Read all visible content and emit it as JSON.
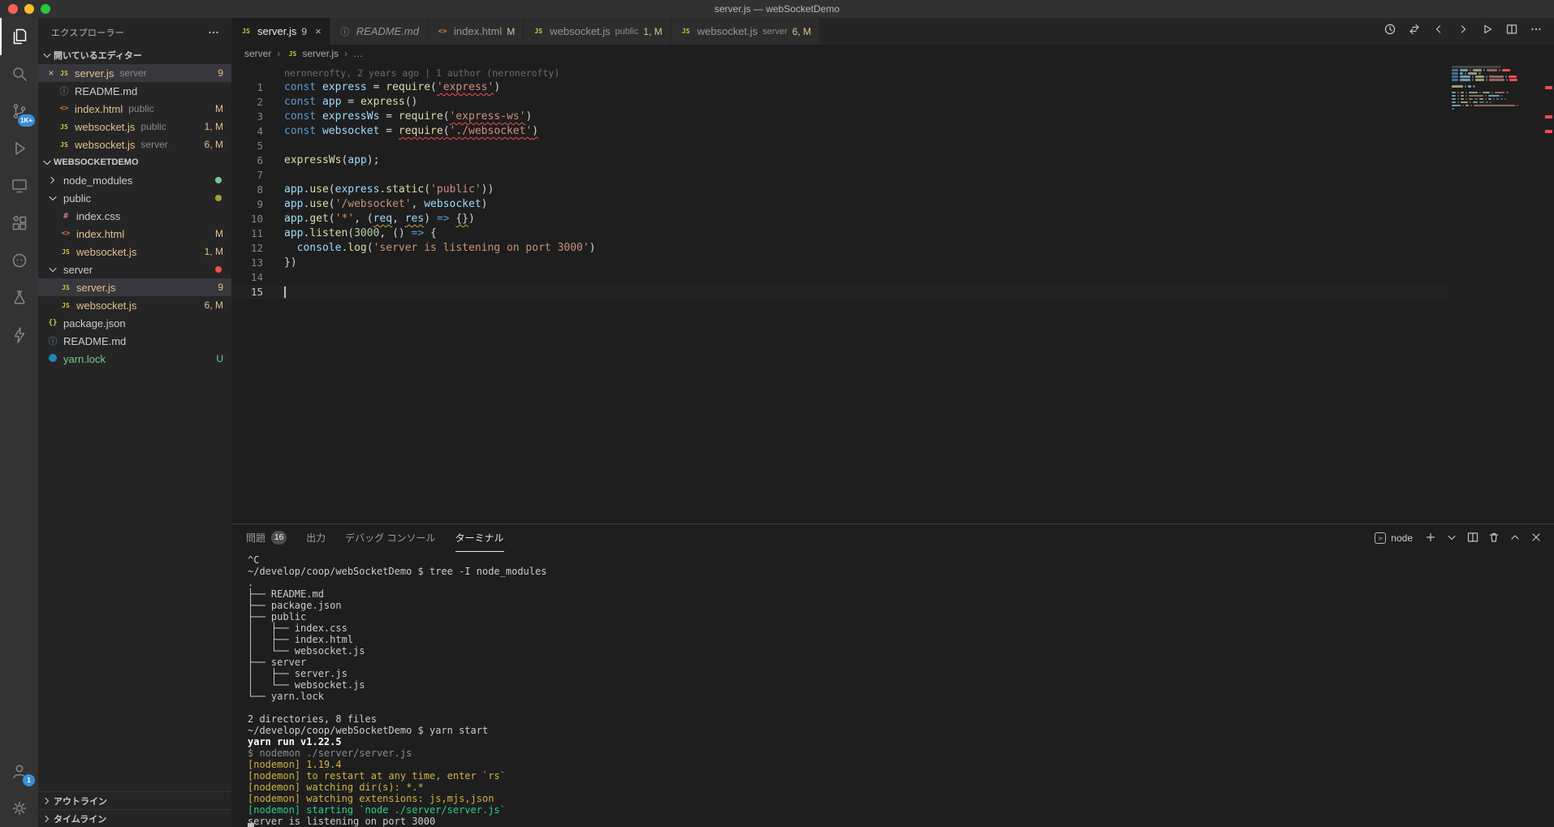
{
  "title_bar": {
    "title": "server.js — webSocketDemo"
  },
  "activity_bar": {
    "top": [
      {
        "id": "explorer",
        "active": true
      },
      {
        "id": "search"
      },
      {
        "id": "source-control",
        "badge": "1K+"
      },
      {
        "id": "run-debug"
      },
      {
        "id": "remote-explorer"
      },
      {
        "id": "extensions"
      },
      {
        "id": "github"
      },
      {
        "id": "testing"
      },
      {
        "id": "lightning"
      }
    ],
    "bottom": [
      {
        "id": "accounts",
        "badge": "1"
      },
      {
        "id": "settings"
      }
    ]
  },
  "sidebar": {
    "title": "エクスプローラー",
    "open_editors": {
      "header": "開いているエディター",
      "items": [
        {
          "icon": "js",
          "name": "server.js",
          "detail": "server",
          "badge": "9",
          "color": "mod",
          "selected": true,
          "close": true
        },
        {
          "icon": "info",
          "name": "README.md",
          "color": "plain"
        },
        {
          "icon": "html",
          "name": "index.html",
          "detail": "public",
          "badge": "M",
          "color": "mod"
        },
        {
          "icon": "js",
          "name": "websocket.js",
          "detail": "public",
          "badge": "1, M",
          "color": "mod"
        },
        {
          "icon": "js",
          "name": "websocket.js",
          "detail": "server",
          "badge": "6, M",
          "color": "mod"
        }
      ]
    },
    "tree": {
      "root": "WEBSOCKETDEMO",
      "items": [
        {
          "type": "folder",
          "name": "node_modules",
          "expanded": false,
          "indent": 0,
          "dot": "#73c991",
          "color": "plain"
        },
        {
          "type": "folder",
          "name": "public",
          "expanded": true,
          "indent": 0,
          "dot": "#a8a238",
          "color": "plain"
        },
        {
          "type": "file",
          "icon": "css",
          "name": "index.css",
          "indent": 1,
          "color": "plain"
        },
        {
          "type": "file",
          "icon": "html",
          "name": "index.html",
          "indent": 1,
          "badge": "M",
          "color": "mod"
        },
        {
          "type": "file",
          "icon": "js",
          "name": "websocket.js",
          "indent": 1,
          "badge": "1, M",
          "color": "mod"
        },
        {
          "type": "folder",
          "name": "server",
          "expanded": true,
          "indent": 0,
          "dot": "#f14c4c",
          "color": "plain"
        },
        {
          "type": "file",
          "icon": "js",
          "name": "server.js",
          "indent": 1,
          "badge": "9",
          "color": "mod",
          "selected": true
        },
        {
          "type": "file",
          "icon": "js",
          "name": "websocket.js",
          "indent": 1,
          "badge": "6, M",
          "color": "mod"
        },
        {
          "type": "file",
          "icon": "json",
          "name": "package.json",
          "indent": 0,
          "color": "plain"
        },
        {
          "type": "file",
          "icon": "info",
          "name": "README.md",
          "indent": 0,
          "color": "plain"
        },
        {
          "type": "file",
          "icon": "yarn",
          "name": "yarn.lock",
          "indent": 0,
          "badge": "U",
          "color": "untracked"
        }
      ]
    },
    "bottom_sections": [
      {
        "label": "アウトライン"
      },
      {
        "label": "タイムライン"
      }
    ]
  },
  "tab_bar": {
    "tabs": [
      {
        "icon": "js",
        "label": "server.js",
        "badge": "9",
        "active": true,
        "close": true
      },
      {
        "icon": "info",
        "label": "README.md",
        "preview": true
      },
      {
        "icon": "html",
        "label": "index.html",
        "badge": "M"
      },
      {
        "icon": "js",
        "label": "websocket.js",
        "detail": "public",
        "badge": "1, M"
      },
      {
        "icon": "js",
        "label": "websocket.js",
        "detail": "server",
        "badge": "6, M"
      }
    ],
    "actions": [
      "history",
      "open-changes",
      "prev-change",
      "next-change",
      "run",
      "split-editor",
      "more"
    ]
  },
  "breadcrumb": {
    "items": [
      "server",
      "server.js",
      "…"
    ]
  },
  "editor": {
    "blame": "neronerofty, 2 years ago | 1 author (neronerofty)",
    "error_lines": [
      1,
      3,
      4
    ],
    "lines": [
      {
        "n": 1,
        "t": [
          [
            "k",
            "const "
          ],
          [
            "v",
            "express"
          ],
          [
            "p",
            " = "
          ],
          [
            "f",
            "require"
          ],
          [
            "p",
            "("
          ],
          [
            "se",
            "'express'"
          ],
          [
            "p",
            ")"
          ]
        ]
      },
      {
        "n": 2,
        "t": [
          [
            "k",
            "const "
          ],
          [
            "v",
            "app"
          ],
          [
            "p",
            " = "
          ],
          [
            "f",
            "express"
          ],
          [
            "p",
            "()"
          ]
        ]
      },
      {
        "n": 3,
        "t": [
          [
            "k",
            "const "
          ],
          [
            "v",
            "expressWs"
          ],
          [
            "p",
            " = "
          ],
          [
            "f",
            "require"
          ],
          [
            "p",
            "("
          ],
          [
            "se",
            "'express-ws'"
          ],
          [
            "p",
            ")"
          ]
        ]
      },
      {
        "n": 4,
        "t": [
          [
            "k",
            "const "
          ],
          [
            "v",
            "websocket"
          ],
          [
            "p",
            " = "
          ],
          [
            "fe",
            "require"
          ],
          [
            "pe",
            "("
          ],
          [
            "se",
            "'./websocket'"
          ],
          [
            "pe",
            ")"
          ]
        ]
      },
      {
        "n": 5,
        "t": []
      },
      {
        "n": 6,
        "t": [
          [
            "f",
            "expressWs"
          ],
          [
            "p",
            "("
          ],
          [
            "v",
            "app"
          ],
          [
            "p",
            ");"
          ]
        ]
      },
      {
        "n": 7,
        "t": []
      },
      {
        "n": 8,
        "t": [
          [
            "v",
            "app"
          ],
          [
            "p",
            "."
          ],
          [
            "f",
            "use"
          ],
          [
            "p",
            "("
          ],
          [
            "v",
            "express"
          ],
          [
            "p",
            "."
          ],
          [
            "f",
            "static"
          ],
          [
            "p",
            "("
          ],
          [
            "s",
            "'public'"
          ],
          [
            "p",
            "))"
          ]
        ]
      },
      {
        "n": 9,
        "t": [
          [
            "v",
            "app"
          ],
          [
            "p",
            "."
          ],
          [
            "f",
            "use"
          ],
          [
            "p",
            "("
          ],
          [
            "s",
            "'/websocket'"
          ],
          [
            "p",
            ", "
          ],
          [
            "v",
            "websocket"
          ],
          [
            "p",
            ")"
          ]
        ]
      },
      {
        "n": 10,
        "t": [
          [
            "v",
            "app"
          ],
          [
            "p",
            "."
          ],
          [
            "f",
            "get"
          ],
          [
            "p",
            "("
          ],
          [
            "s",
            "'*'"
          ],
          [
            "p",
            ", ("
          ],
          [
            "vw",
            "req"
          ],
          [
            "p",
            ", "
          ],
          [
            "vw",
            "res"
          ],
          [
            "p",
            ") "
          ],
          [
            "k",
            "=>"
          ],
          [
            "p",
            " "
          ],
          [
            "pw",
            "{}"
          ],
          [
            "p",
            ")"
          ]
        ]
      },
      {
        "n": 11,
        "t": [
          [
            "v",
            "app"
          ],
          [
            "p",
            "."
          ],
          [
            "f",
            "listen"
          ],
          [
            "p",
            "("
          ],
          [
            "n2",
            "3000"
          ],
          [
            "p",
            ", () "
          ],
          [
            "k",
            "=>"
          ],
          [
            "p",
            " {"
          ]
        ]
      },
      {
        "n": 12,
        "t": [
          [
            "p",
            "  "
          ],
          [
            "v",
            "console"
          ],
          [
            "p",
            "."
          ],
          [
            "f",
            "log"
          ],
          [
            "p",
            "("
          ],
          [
            "s",
            "'server is listening on port 3000'"
          ],
          [
            "p",
            ")"
          ]
        ]
      },
      {
        "n": 13,
        "t": [
          [
            "p",
            "})"
          ]
        ]
      },
      {
        "n": 14,
        "t": []
      },
      {
        "n": 15,
        "t": [],
        "cursor": true
      }
    ]
  },
  "panel": {
    "tabs": [
      {
        "label": "問題",
        "badge": "16"
      },
      {
        "label": "出力"
      },
      {
        "label": "デバッグ コンソール"
      },
      {
        "label": "ターミナル",
        "active": true
      }
    ],
    "shell": {
      "label": "node"
    },
    "actions": [
      "plus",
      "chevron-down",
      "split",
      "trash",
      "chevron-up",
      "close"
    ],
    "terminal": [
      {
        "c": "fg",
        "text": "^C"
      },
      {
        "c": "fg",
        "text": "~/develop/coop/webSocketDemo $ tree -I node_modules"
      },
      {
        "c": "fg",
        "text": "."
      },
      {
        "c": "fg",
        "text": "├── README.md"
      },
      {
        "c": "fg",
        "text": "├── package.json"
      },
      {
        "c": "fg",
        "text": "├── public"
      },
      {
        "c": "fg",
        "text": "│   ├── index.css"
      },
      {
        "c": "fg",
        "text": "│   ├── index.html"
      },
      {
        "c": "fg",
        "text": "│   └── websocket.js"
      },
      {
        "c": "fg",
        "text": "├── server"
      },
      {
        "c": "fg",
        "text": "│   ├── server.js"
      },
      {
        "c": "fg",
        "text": "│   └── websocket.js"
      },
      {
        "c": "fg",
        "text": "└── yarn.lock"
      },
      {
        "c": "fg",
        "text": ""
      },
      {
        "c": "fg",
        "text": "2 directories, 8 files"
      },
      {
        "c": "fg",
        "text": "~/develop/coop/webSocketDemo $ yarn start"
      },
      {
        "c": "bold",
        "text": "yarn run v1.22.5"
      },
      {
        "c": "dim",
        "text": "$ nodemon ./server/server.js"
      },
      {
        "c": "yellow",
        "text": "[nodemon] 1.19.4"
      },
      {
        "c": "yellow",
        "text": "[nodemon] to restart at any time, enter `rs`"
      },
      {
        "c": "yellow",
        "text": "[nodemon] watching dir(s): *.*"
      },
      {
        "c": "yellow",
        "text": "[nodemon] watching extensions: js,mjs,json"
      },
      {
        "c": "green",
        "text": "[nodemon] starting `node ./server/server.js`"
      },
      {
        "c": "fg",
        "text": "server is listening on port 3000"
      }
    ]
  }
}
